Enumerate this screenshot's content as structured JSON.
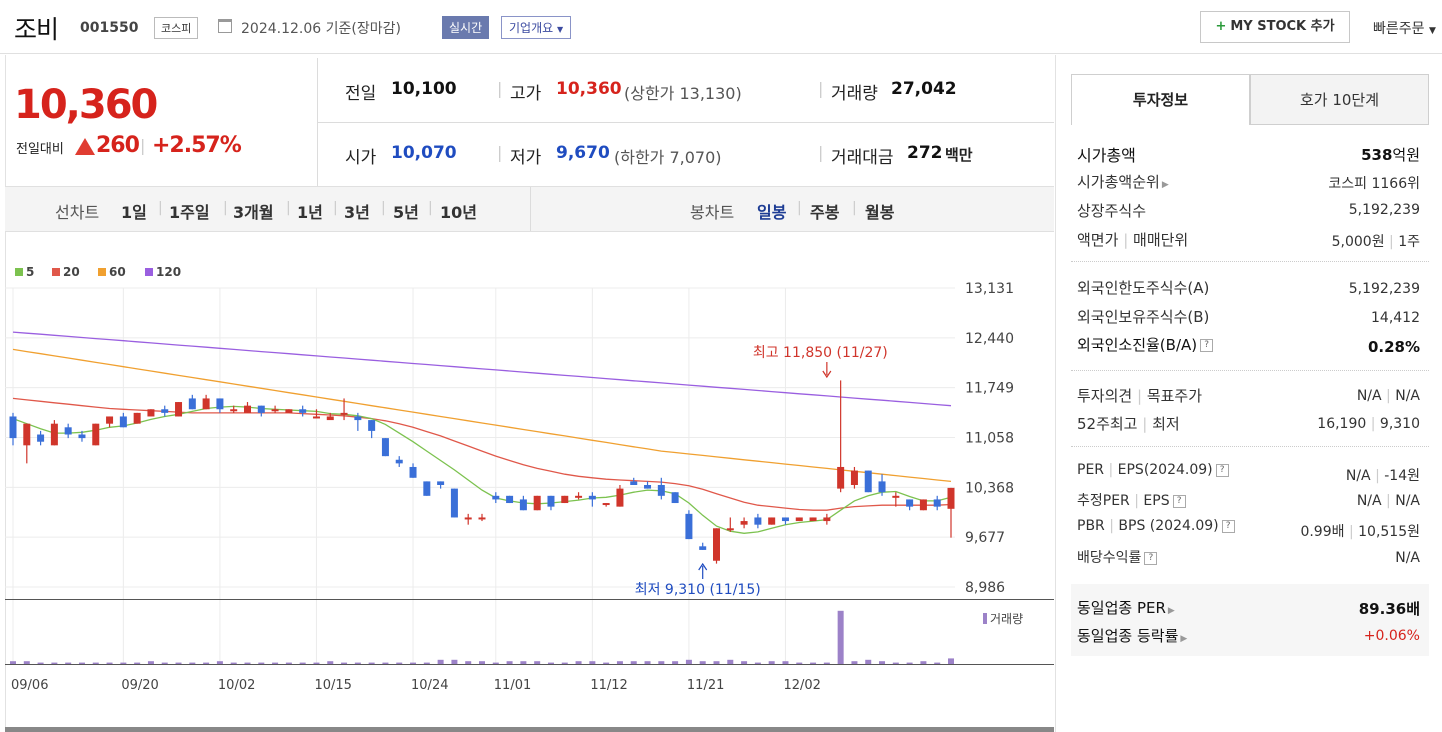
{
  "header": {
    "company": "조비",
    "code": "001550",
    "market": "코스피",
    "date": "2024.12.06  기준(장마감)",
    "realtime_label": "실시간",
    "corp_info_label": "기업개요",
    "mystock_plus": "+",
    "mystock_label": "MY STOCK 추가",
    "quick_order_label": "빠른주문"
  },
  "price": {
    "current": "10,360",
    "change_label": "전일대비",
    "change": "260",
    "change_pct": "+2.57%",
    "prev_label": "전일",
    "prev": "10,100",
    "open_label": "시가",
    "open": "10,070",
    "high_label": "고가",
    "high": "10,360",
    "upper_limit": "(상한가 13,130)",
    "low_label": "저가",
    "low": "9,670",
    "lower_limit": "(하한가 7,070)",
    "volume_label": "거래량",
    "volume": "27,042",
    "amount_label": "거래대금",
    "amount": "272",
    "amount_unit": "백만"
  },
  "periods": {
    "line_label": "선차트",
    "items": [
      "1일",
      "1주일",
      "3개월",
      "1년",
      "3년",
      "5년",
      "10년"
    ],
    "candle_label": "봉차트",
    "candle_items": [
      "일봉",
      "주봉",
      "월봉"
    ],
    "active_candle": "일봉"
  },
  "colors": {
    "up": "#d0352b",
    "down": "#3a6fd8",
    "ma5": "#7cc24f",
    "ma20": "#e0584a",
    "ma60": "#f0a030",
    "ma120": "#9a5fe0",
    "volume": "#9c82c8"
  },
  "chart_data": {
    "type": "candlestick",
    "legend": [
      "5",
      "20",
      "60",
      "120"
    ],
    "yticks": [
      "13,131",
      "12,440",
      "11,749",
      "11,058",
      "10,368",
      "9,677",
      "8,986"
    ],
    "ylim": [
      8986,
      13131
    ],
    "xticks": [
      {
        "label": "09/06",
        "i": 0
      },
      {
        "label": "09/20",
        "i": 8
      },
      {
        "label": "10/02",
        "i": 15
      },
      {
        "label": "10/15",
        "i": 22
      },
      {
        "label": "10/24",
        "i": 29
      },
      {
        "label": "11/01",
        "i": 35
      },
      {
        "label": "11/12",
        "i": 42
      },
      {
        "label": "11/21",
        "i": 49
      },
      {
        "label": "12/02",
        "i": 56
      }
    ],
    "candles": [
      {
        "o": 11350,
        "h": 11400,
        "c": 11050,
        "l": 10950
      },
      {
        "o": 10950,
        "h": 11250,
        "c": 11250,
        "l": 10700
      },
      {
        "o": 11100,
        "h": 11150,
        "c": 11000,
        "l": 10950
      },
      {
        "o": 10950,
        "h": 11300,
        "c": 11250,
        "l": 10950
      },
      {
        "o": 11200,
        "h": 11250,
        "c": 11100,
        "l": 11050
      },
      {
        "o": 11100,
        "h": 11150,
        "c": 11050,
        "l": 11000
      },
      {
        "o": 10950,
        "h": 11250,
        "c": 11250,
        "l": 10950
      },
      {
        "o": 11250,
        "h": 11350,
        "c": 11350,
        "l": 11200
      },
      {
        "o": 11350,
        "h": 11400,
        "c": 11200,
        "l": 11200
      },
      {
        "o": 11250,
        "h": 11400,
        "c": 11400,
        "l": 11250
      },
      {
        "o": 11350,
        "h": 11450,
        "c": 11450,
        "l": 11350
      },
      {
        "o": 11450,
        "h": 11500,
        "c": 11400,
        "l": 11350
      },
      {
        "o": 11350,
        "h": 11550,
        "c": 11550,
        "l": 11350
      },
      {
        "o": 11600,
        "h": 11650,
        "c": 11450,
        "l": 11450
      },
      {
        "o": 11450,
        "h": 11650,
        "c": 11600,
        "l": 11450
      },
      {
        "o": 11600,
        "h": 11600,
        "c": 11450,
        "l": 11400
      },
      {
        "o": 11450,
        "h": 11500,
        "c": 11450,
        "l": 11400
      },
      {
        "o": 11400,
        "h": 11550,
        "c": 11500,
        "l": 11400
      },
      {
        "o": 11500,
        "h": 11500,
        "c": 11400,
        "l": 11350
      },
      {
        "o": 11450,
        "h": 11500,
        "c": 11450,
        "l": 11400
      },
      {
        "o": 11400,
        "h": 11450,
        "c": 11450,
        "l": 11400
      },
      {
        "o": 11450,
        "h": 11500,
        "c": 11400,
        "l": 11350
      },
      {
        "o": 11350,
        "h": 11450,
        "c": 11350,
        "l": 11350
      },
      {
        "o": 11300,
        "h": 11400,
        "c": 11350,
        "l": 11350
      },
      {
        "o": 11400,
        "h": 11600,
        "c": 11400,
        "l": 11300
      },
      {
        "o": 11350,
        "h": 11400,
        "c": 11300,
        "l": 11150
      },
      {
        "o": 11300,
        "h": 11300,
        "c": 11150,
        "l": 11050
      },
      {
        "o": 11050,
        "h": 11050,
        "c": 10800,
        "l": 10800
      },
      {
        "o": 10750,
        "h": 10800,
        "c": 10700,
        "l": 10650
      },
      {
        "o": 10650,
        "h": 10700,
        "c": 10500,
        "l": 10500
      },
      {
        "o": 10450,
        "h": 10450,
        "c": 10250,
        "l": 10250
      },
      {
        "o": 10450,
        "h": 10450,
        "c": 10400,
        "l": 10350
      },
      {
        "o": 10350,
        "h": 10350,
        "c": 9950,
        "l": 9950
      },
      {
        "o": 9950,
        "h": 10000,
        "c": 9950,
        "l": 9850
      },
      {
        "o": 9950,
        "h": 10000,
        "c": 9950,
        "l": 9900
      },
      {
        "o": 10250,
        "h": 10300,
        "c": 10200,
        "l": 10150
      },
      {
        "o": 10250,
        "h": 10250,
        "c": 10150,
        "l": 10150
      },
      {
        "o": 10200,
        "h": 10250,
        "c": 10050,
        "l": 10050
      },
      {
        "o": 10050,
        "h": 10250,
        "c": 10250,
        "l": 10050
      },
      {
        "o": 10250,
        "h": 10250,
        "c": 10100,
        "l": 10050
      },
      {
        "o": 10150,
        "h": 10250,
        "c": 10250,
        "l": 10150
      },
      {
        "o": 10250,
        "h": 10300,
        "c": 10250,
        "l": 10200
      },
      {
        "o": 10250,
        "h": 10300,
        "c": 10200,
        "l": 10100
      },
      {
        "o": 10150,
        "h": 10150,
        "c": 10150,
        "l": 10100
      },
      {
        "o": 10100,
        "h": 10400,
        "c": 10350,
        "l": 10100
      },
      {
        "o": 10450,
        "h": 10500,
        "c": 10400,
        "l": 10400
      },
      {
        "o": 10400,
        "h": 10450,
        "c": 10350,
        "l": 10350
      },
      {
        "o": 10400,
        "h": 10500,
        "c": 10250,
        "l": 10200
      },
      {
        "o": 10300,
        "h": 10300,
        "c": 10150,
        "l": 10150
      },
      {
        "o": 10000,
        "h": 10050,
        "c": 9650,
        "l": 9650
      },
      {
        "o": 9550,
        "h": 9600,
        "c": 9500,
        "l": 9500
      },
      {
        "o": 9350,
        "h": 9800,
        "c": 9800,
        "l": 9310
      },
      {
        "o": 9800,
        "h": 9950,
        "c": 9800,
        "l": 9750
      },
      {
        "o": 9850,
        "h": 9950,
        "c": 9900,
        "l": 9800
      },
      {
        "o": 9950,
        "h": 10000,
        "c": 9850,
        "l": 9800
      },
      {
        "o": 9850,
        "h": 9950,
        "c": 9950,
        "l": 9850
      },
      {
        "o": 9950,
        "h": 9950,
        "c": 9900,
        "l": 9850
      },
      {
        "o": 9900,
        "h": 9950,
        "c": 9950,
        "l": 9900
      },
      {
        "o": 9900,
        "h": 9950,
        "c": 9950,
        "l": 9900
      },
      {
        "o": 9900,
        "h": 10000,
        "c": 9950,
        "l": 9850
      },
      {
        "o": 10350,
        "h": 11850,
        "c": 10650,
        "l": 10300
      },
      {
        "o": 10400,
        "h": 10650,
        "c": 10600,
        "l": 10350
      },
      {
        "o": 10600,
        "h": 10600,
        "c": 10300,
        "l": 10300
      },
      {
        "o": 10450,
        "h": 10550,
        "c": 10300,
        "l": 10250
      },
      {
        "o": 10250,
        "h": 10300,
        "c": 10250,
        "l": 10100
      },
      {
        "o": 10200,
        "h": 10200,
        "c": 10100,
        "l": 10050
      },
      {
        "o": 10050,
        "h": 10200,
        "c": 10200,
        "l": 10050
      },
      {
        "o": 10200,
        "h": 10250,
        "c": 10100,
        "l": 10050
      },
      {
        "o": 10070,
        "h": 10360,
        "c": 10360,
        "l": 9670
      }
    ],
    "ma": {
      "5": [
        11320,
        11250,
        11180,
        11120,
        11120,
        11130,
        11160,
        11200,
        11220,
        11260,
        11310,
        11350,
        11380,
        11420,
        11460,
        11480,
        11490,
        11480,
        11460,
        11450,
        11440,
        11430,
        11420,
        11390,
        11380,
        11360,
        11320,
        11240,
        11120,
        11000,
        10870,
        10740,
        10610,
        10470,
        10330,
        10220,
        10180,
        10150,
        10140,
        10150,
        10170,
        10190,
        10220,
        10230,
        10260,
        10300,
        10330,
        10320,
        10280,
        10150,
        9980,
        9830,
        9760,
        9730,
        9750,
        9800,
        9850,
        9880,
        9900,
        9920,
        10050,
        10180,
        10250,
        10300,
        10310,
        10240,
        10180,
        10180,
        10230
      ],
      "20": [
        11600,
        11580,
        11560,
        11540,
        11520,
        11500,
        11480,
        11460,
        11450,
        11440,
        11430,
        11420,
        11410,
        11400,
        11400,
        11400,
        11400,
        11400,
        11400,
        11400,
        11400,
        11390,
        11380,
        11370,
        11360,
        11340,
        11320,
        11290,
        11250,
        11200,
        11140,
        11080,
        11010,
        10940,
        10870,
        10800,
        10740,
        10680,
        10630,
        10590,
        10550,
        10520,
        10500,
        10480,
        10470,
        10460,
        10450,
        10440,
        10420,
        10390,
        10340,
        10280,
        10220,
        10160,
        10120,
        10100,
        10080,
        10060,
        10050,
        10050,
        10080,
        10100,
        10110,
        10120,
        10120,
        10120,
        10120,
        10120,
        10130
      ],
      "60": [
        12280,
        12250,
        12220,
        12190,
        12160,
        12130,
        12100,
        12070,
        12040,
        12010,
        11980,
        11950,
        11920,
        11890,
        11860,
        11830,
        11800,
        11770,
        11740,
        11710,
        11680,
        11650,
        11620,
        11590,
        11560,
        11530,
        11500,
        11470,
        11440,
        11410,
        11380,
        11350,
        11320,
        11290,
        11260,
        11230,
        11200,
        11170,
        11140,
        11110,
        11080,
        11050,
        11020,
        10990,
        10960,
        10930,
        10900,
        10870,
        10850,
        10830,
        10810,
        10790,
        10770,
        10750,
        10730,
        10710,
        10690,
        10670,
        10650,
        10630,
        10610,
        10590,
        10570,
        10550,
        10530,
        10510,
        10490,
        10470,
        10450
      ],
      "120": [
        12520,
        12505,
        12490,
        12475,
        12460,
        12445,
        12430,
        12415,
        12400,
        12385,
        12370,
        12355,
        12340,
        12325,
        12310,
        12295,
        12280,
        12265,
        12250,
        12235,
        12220,
        12205,
        12190,
        12175,
        12160,
        12145,
        12130,
        12115,
        12100,
        12085,
        12070,
        12055,
        12040,
        12025,
        12010,
        11995,
        11980,
        11965,
        11950,
        11935,
        11920,
        11905,
        11890,
        11875,
        11860,
        11845,
        11830,
        11815,
        11800,
        11785,
        11770,
        11755,
        11740,
        11725,
        11710,
        11695,
        11680,
        11665,
        11650,
        11635,
        11620,
        11605,
        11590,
        11575,
        11560,
        11545,
        11530,
        11515,
        11500
      ]
    },
    "volume_label": "거래량",
    "volume": [
      2,
      2,
      1,
      1,
      1,
      1,
      1,
      1,
      1,
      1,
      2,
      1,
      1,
      1,
      1,
      2,
      1,
      1,
      1,
      1,
      1,
      1,
      1,
      2,
      1,
      1,
      1,
      1,
      1,
      1,
      1,
      3,
      3,
      2,
      2,
      1,
      2,
      2,
      2,
      1,
      1,
      2,
      2,
      1,
      2,
      2,
      2,
      2,
      2,
      3,
      2,
      2,
      3,
      2,
      1,
      2,
      2,
      1,
      1,
      1,
      38,
      2,
      3,
      2,
      1,
      1,
      2,
      1,
      4
    ],
    "high_label": "최고 11,850 (11/27)",
    "low_label": "최저 9,310 (11/15)"
  },
  "invest": {
    "tab_invest": "투자정보",
    "tab_hoga": "호가 10단계",
    "market_cap_label": "시가총액",
    "market_cap": "538",
    "market_cap_unit": "억원",
    "rank_label": "시가총액순위",
    "rank": "코스피 1166위",
    "shares_label": "상장주식수",
    "shares": "5,192,239",
    "par_label": "액면가",
    "unit_label": "매매단위",
    "par": "5,000원",
    "unit": "1주",
    "foreign_limit_label": "외국인한도주식수(A)",
    "foreign_limit": "5,192,239",
    "foreign_hold_label": "외국인보유주식수(B)",
    "foreign_hold": "14,412",
    "foreign_ratio_label": "외국인소진율(B/A)",
    "foreign_ratio": "0.28%",
    "opinion_label": "투자의견",
    "target_label": "목표주가",
    "opinion": "N/A",
    "target": "N/A",
    "w52_high_label": "52주최고",
    "w52_low_label": "최저",
    "w52_high": "16,190",
    "w52_low": "9,310",
    "per_label": "PER",
    "eps_label": "EPS(2024.09)",
    "per": "N/A",
    "eps": "-14원",
    "est_per_label": "추정PER",
    "est_eps_label": "EPS",
    "est_per": "N/A",
    "est_eps": "N/A",
    "pbr_label": "PBR",
    "bps_label": "BPS (2024.09)",
    "pbr": "0.99배",
    "bps": "10,515원",
    "div_label": "배당수익률",
    "div": "N/A",
    "peer_per_label": "동일업종 PER",
    "peer_per": "89.36배",
    "peer_rate_label": "동일업종 등락률",
    "peer_rate": "+0.06%"
  }
}
